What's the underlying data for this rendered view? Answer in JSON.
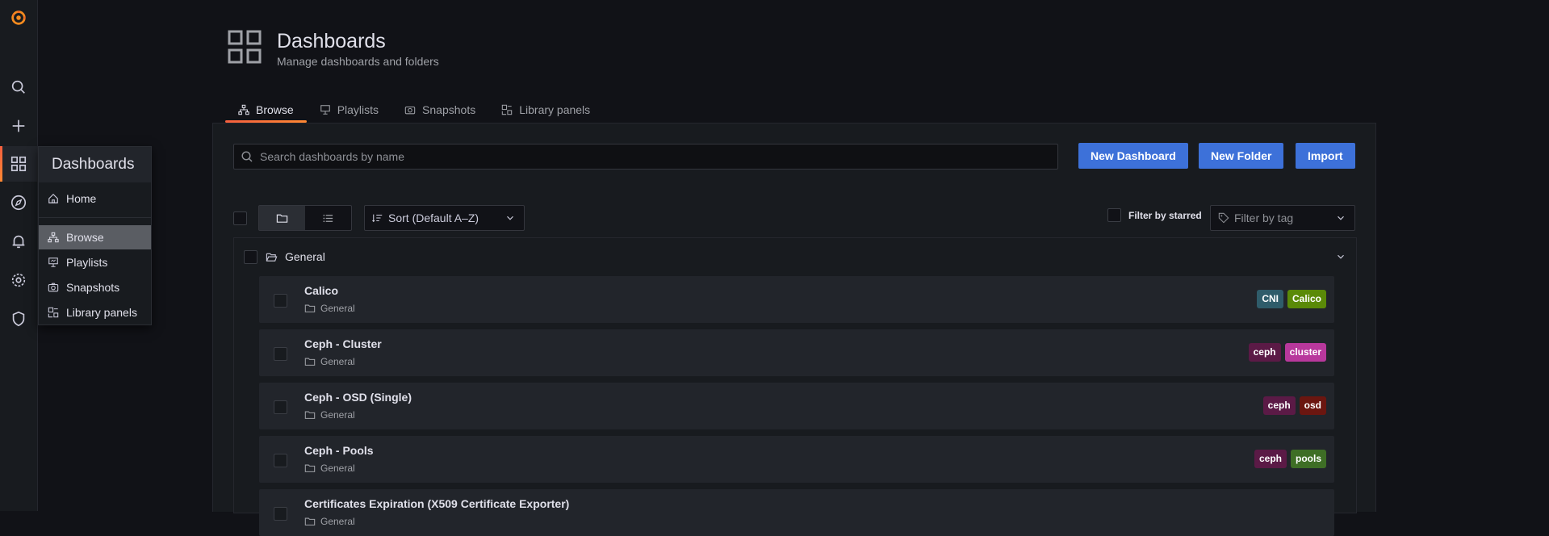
{
  "nav": {
    "items": [
      "grafana-logo",
      "search-icon",
      "plus-icon",
      "dashboards-icon",
      "explore-icon",
      "alerting-icon",
      "configuration-icon",
      "shield-icon"
    ],
    "active": "dashboards"
  },
  "flyout": {
    "title": "Dashboards",
    "items": [
      {
        "label": "Home",
        "icon": "home-icon"
      },
      {
        "label": "Browse",
        "icon": "sitemap-icon",
        "selected": true
      },
      {
        "label": "Playlists",
        "icon": "presentation-icon"
      },
      {
        "label": "Snapshots",
        "icon": "camera-icon"
      },
      {
        "label": "Library panels",
        "icon": "library-panel-icon"
      }
    ]
  },
  "header": {
    "title": "Dashboards",
    "subtitle": "Manage dashboards and folders"
  },
  "tabs": [
    {
      "label": "Browse",
      "icon": "sitemap-icon",
      "active": true
    },
    {
      "label": "Playlists",
      "icon": "presentation-icon"
    },
    {
      "label": "Snapshots",
      "icon": "camera-icon"
    },
    {
      "label": "Library panels",
      "icon": "library-panel-icon"
    }
  ],
  "toolbar": {
    "search_placeholder": "Search dashboards by name",
    "new_dashboard": "New Dashboard",
    "new_folder": "New Folder",
    "import": "Import",
    "sort_label": "Sort (Default A–Z)",
    "filter_starred": "Filter by starred",
    "filter_tag_placeholder": "Filter by tag"
  },
  "folder": {
    "name": "General"
  },
  "dashboards": [
    {
      "title": "Calico",
      "folder": "General",
      "tags": [
        {
          "label": "CNI",
          "color": "#2f5c6a"
        },
        {
          "label": "Calico",
          "color": "#5a8a08"
        }
      ]
    },
    {
      "title": "Ceph - Cluster",
      "folder": "General",
      "tags": [
        {
          "label": "ceph",
          "color": "#5b1a46"
        },
        {
          "label": "cluster",
          "color": "#b8389c"
        }
      ]
    },
    {
      "title": "Ceph - OSD (Single)",
      "folder": "General",
      "tags": [
        {
          "label": "ceph",
          "color": "#5b1a46"
        },
        {
          "label": "osd",
          "color": "#6b1610"
        }
      ]
    },
    {
      "title": "Ceph - Pools",
      "folder": "General",
      "tags": [
        {
          "label": "ceph",
          "color": "#5b1a46"
        },
        {
          "label": "pools",
          "color": "#3e6e25"
        }
      ]
    },
    {
      "title": "Certificates Expiration (X509 Certificate Exporter)",
      "folder": "General",
      "tags": []
    }
  ],
  "colors": {
    "accent": "#3d71d9",
    "active_gradient_start": "#f55f3e",
    "active_gradient_end": "#ff8833"
  }
}
